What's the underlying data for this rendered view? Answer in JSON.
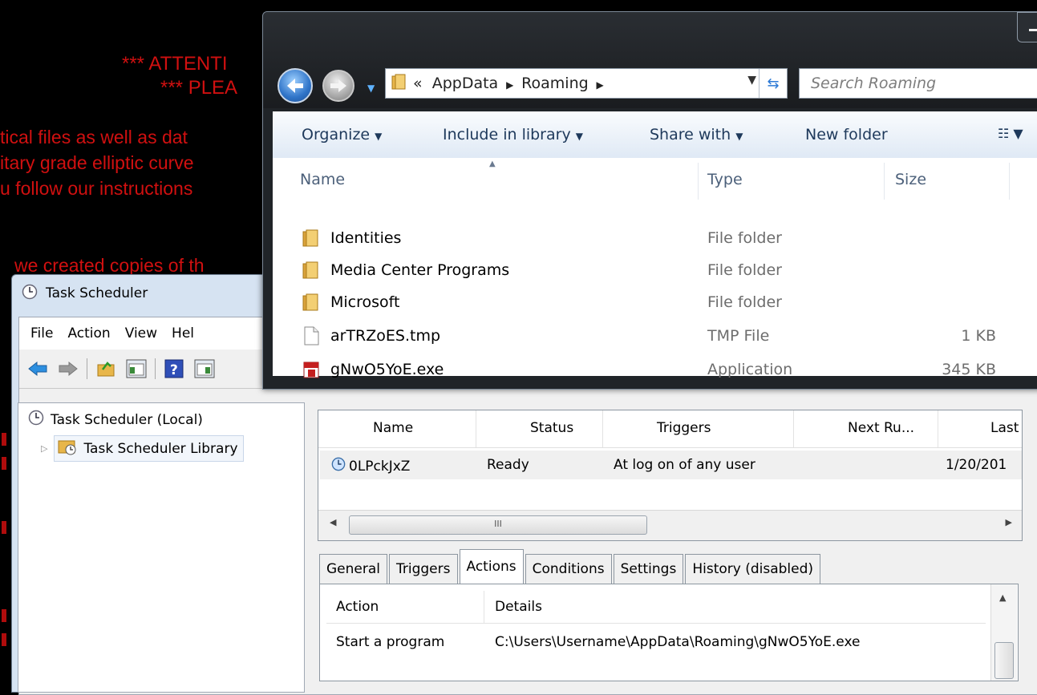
{
  "ransom": {
    "attention": "*** ATTENTI",
    "please": "*** PLEA",
    "line1": "tical files as well as dat",
    "line2": "itary grade elliptic curve",
    "line3": "u follow our instructions",
    "line4": "we created copies of th"
  },
  "task_scheduler": {
    "title": "Task Scheduler",
    "menu": [
      "File",
      "Action",
      "View",
      "Hel"
    ],
    "tree": {
      "root": "Task Scheduler (Local)",
      "library": "Task Scheduler Library"
    },
    "task_list": {
      "columns": [
        "Name",
        "Status",
        "Triggers",
        "Next Ru...",
        "Last"
      ],
      "rows": [
        {
          "name": "0LPckJxZ",
          "status": "Ready",
          "triggers": "At log on of any user",
          "next_run": "",
          "last": "1/20/201"
        }
      ],
      "scroll_grip": "III"
    },
    "tabs": [
      "General",
      "Triggers",
      "Actions",
      "Conditions",
      "Settings",
      "History (disabled)"
    ],
    "active_tab": "Actions",
    "actions": {
      "columns": [
        "Action",
        "Details"
      ],
      "rows": [
        {
          "action": "Start a program",
          "details": "C:\\Users\\Username\\AppData\\Roaming\\gNwO5YoE.exe"
        }
      ]
    }
  },
  "explorer": {
    "address": {
      "prefix": "«",
      "crumbs": [
        "AppData",
        "Roaming"
      ]
    },
    "search_placeholder": "Search Roaming",
    "commands": [
      "Organize",
      "Include in library",
      "Share with",
      "New folder"
    ],
    "columns": [
      "Name",
      "Type",
      "Size"
    ],
    "files": [
      {
        "name": "Identities",
        "type": "File folder",
        "size": "",
        "icon": "folder-icon"
      },
      {
        "name": "Media Center Programs",
        "type": "File folder",
        "size": "",
        "icon": "folder-icon"
      },
      {
        "name": "Microsoft",
        "type": "File folder",
        "size": "",
        "icon": "folder-icon"
      },
      {
        "name": "arTRZoES.tmp",
        "type": "TMP File",
        "size": "1 KB",
        "icon": "file-icon"
      },
      {
        "name": "gNwO5YoE.exe",
        "type": "Application",
        "size": "345 KB",
        "icon": "exe-icon"
      }
    ]
  },
  "colors": {
    "ransom_text": "#d01010",
    "window_frame": "#d6e3f2",
    "explorer_glass": "#202428"
  }
}
